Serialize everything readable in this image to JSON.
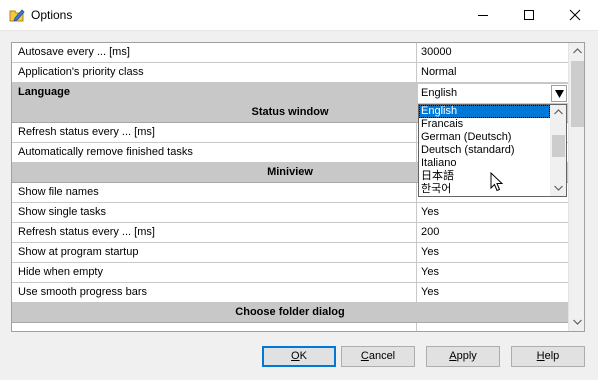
{
  "window": {
    "title": "Options"
  },
  "grid": {
    "rows": [
      {
        "label": "Autosave every ... [ms]",
        "value": "30000"
      },
      {
        "label": "Application's priority class",
        "value": "Normal"
      },
      {
        "label": "Language",
        "value": "English"
      },
      {
        "section": "Status window"
      },
      {
        "label": "Refresh status every ... [ms]",
        "value": ""
      },
      {
        "label": "Automatically remove finished tasks",
        "value": ""
      },
      {
        "section": "Miniview"
      },
      {
        "label": "Show file names",
        "value": "Yes"
      },
      {
        "label": "Show single tasks",
        "value": "Yes"
      },
      {
        "label": "Refresh status every ... [ms]",
        "value": "200"
      },
      {
        "label": "Show at program startup",
        "value": "Yes"
      },
      {
        "label": "Hide when empty",
        "value": "Yes"
      },
      {
        "label": "Use smooth progress bars",
        "value": "Yes"
      },
      {
        "section": "Choose folder dialog"
      }
    ]
  },
  "language_dropdown": {
    "selected": "English",
    "options": [
      "English",
      "Francais",
      "German (Deutsch)",
      "Deutsch (standard)",
      "Italiano",
      "日本語",
      "한국어"
    ]
  },
  "buttons": {
    "ok_first": "O",
    "ok_rest": "K",
    "cancel_first": "C",
    "cancel_rest": "ancel",
    "apply_first": "A",
    "apply_rest": "pply",
    "help_first": "H",
    "help_rest": "elp"
  },
  "colors": {
    "accent": "#0078d7",
    "section_bg": "#c8c8c8",
    "dialog_bg": "#f0f0f0"
  },
  "icons": {
    "app": "folder-pencil-icon",
    "minimize": "minimize-icon",
    "maximize": "maximize-icon",
    "close": "close-icon"
  }
}
